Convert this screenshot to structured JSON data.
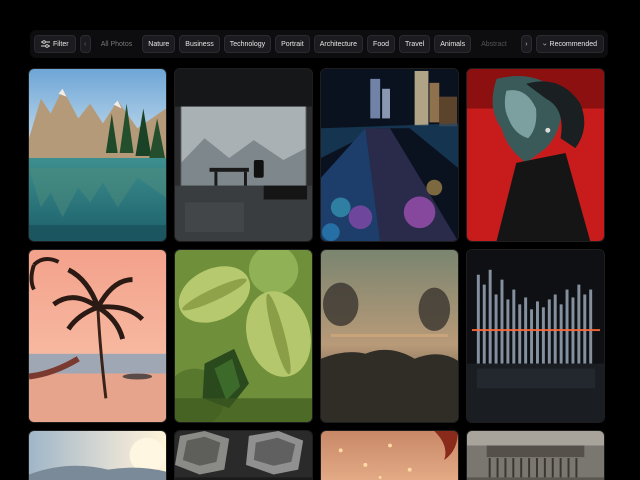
{
  "toolbar": {
    "filter_label": "Filter",
    "filter_icon": "sliders-icon",
    "prev_icon": "chevron-left-icon",
    "next_icon": "chevron-right-icon",
    "categories": [
      "All Photos",
      "Nature",
      "Business",
      "Technology",
      "Portrait",
      "Architecture",
      "Food",
      "Travel",
      "Animals",
      "Abstract"
    ],
    "active_category": "All Photos",
    "sort_label": "Recommended",
    "sort_icon": "chevron-down-icon"
  },
  "gallery": {
    "images": [
      {
        "subject": "mountain lake with pine trees"
      },
      {
        "subject": "modern glass office with desk and chair"
      },
      {
        "subject": "city skyline at night with neon street"
      },
      {
        "subject": "portrait of woman in red light"
      },
      {
        "subject": "palm tree and hammock at sunset beach"
      },
      {
        "subject": "green macarons with mint leaves"
      },
      {
        "subject": "blurred silhouettes at dusk"
      },
      {
        "subject": "abstract glass sound wave bars"
      },
      {
        "subject": "hazy sunrise landscape"
      },
      {
        "subject": "hexagonal concrete structure"
      },
      {
        "subject": "sky with floating lanterns"
      },
      {
        "subject": "interior ceiling architecture"
      }
    ]
  },
  "colors": {
    "background": "#000000",
    "toolbar_bg": "#0d0d0f",
    "chip_bg": "#1c1c20",
    "text": "#e6e6e6"
  }
}
